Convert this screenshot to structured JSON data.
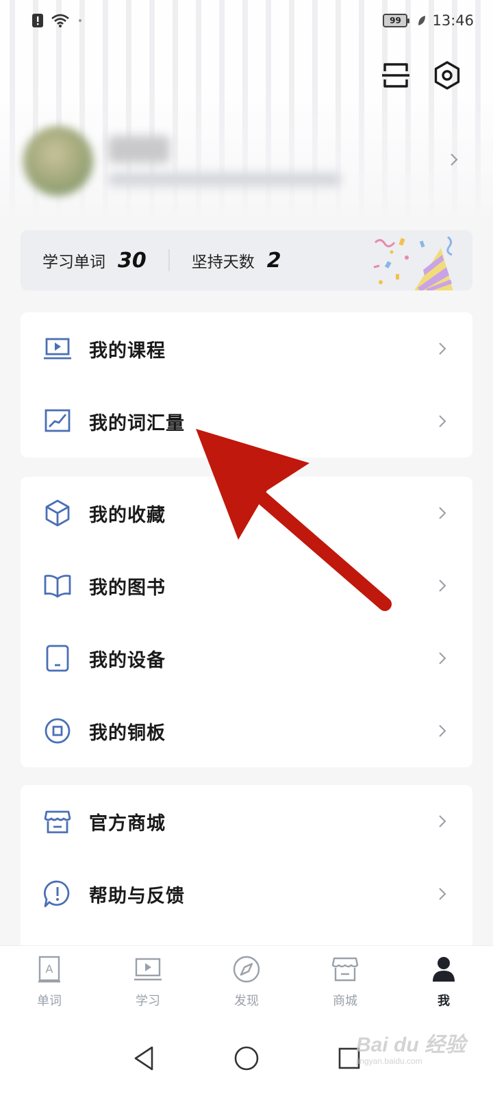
{
  "status_bar": {
    "time": "13:46",
    "battery": "99"
  },
  "stats": {
    "words_label": "学习单词",
    "words_value": "30",
    "days_label": "坚持天数",
    "days_value": "2"
  },
  "menu_group_1": [
    {
      "label": "我的课程",
      "icon": "laptop-play-icon"
    },
    {
      "label": "我的词汇量",
      "icon": "chart-line-icon"
    }
  ],
  "menu_group_2": [
    {
      "label": "我的收藏",
      "icon": "cube-icon"
    },
    {
      "label": "我的图书",
      "icon": "book-icon"
    },
    {
      "label": "我的设备",
      "icon": "device-icon"
    },
    {
      "label": "我的铜板",
      "icon": "coin-icon"
    }
  ],
  "menu_group_3": [
    {
      "label": "官方商城",
      "icon": "store-icon"
    },
    {
      "label": "帮助与反馈",
      "icon": "feedback-icon"
    }
  ],
  "tabs": [
    {
      "label": "单词",
      "icon": "word-card-icon",
      "active": false
    },
    {
      "label": "学习",
      "icon": "laptop-play-icon",
      "active": false
    },
    {
      "label": "发现",
      "icon": "compass-icon",
      "active": false
    },
    {
      "label": "商城",
      "icon": "store-icon",
      "active": false
    },
    {
      "label": "我",
      "icon": "person-icon",
      "active": true
    }
  ],
  "watermark": {
    "brand": "Bai du 经验",
    "url": "jingyan.baidu.com"
  },
  "colors": {
    "accent": "#4a6fb5",
    "arrow": "#c0180c",
    "active_tab": "#1f2329",
    "inactive_tab": "#9aa0aa"
  }
}
